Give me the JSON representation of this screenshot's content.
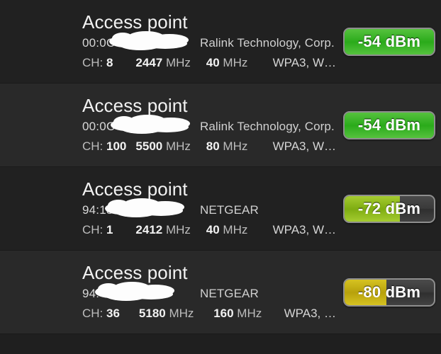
{
  "screen": {
    "name": "wifi-access-point-scan-list",
    "background_color": "#1f1f1f",
    "row_bg_dark": "#212121",
    "row_bg_light": "#292929"
  },
  "labels": {
    "channel_label": "CH:",
    "mhz_unit": "MHz",
    "dbm_unit": "dBm"
  },
  "access_points": [
    {
      "title": "Access point",
      "mac": "00:0C",
      "mac_redacted": true,
      "vendor": "Ralink Technology, Corp.",
      "channel": "8",
      "frequency": "2447",
      "bandwidth": "40",
      "security": "WPA3, W…",
      "signal_value": "-54",
      "signal_text": "-54 dBm",
      "signal_fill_percent": 100,
      "signal_color": "#2bab1b",
      "signal_color_light": "#56c23e",
      "row_background": "#212121"
    },
    {
      "title": "Access point",
      "mac": "00:0C",
      "mac_redacted": true,
      "vendor": "Ralink Technology, Corp.",
      "channel": "100",
      "frequency": "5500",
      "bandwidth": "80",
      "security": "WPA3, W…",
      "signal_value": "-54",
      "signal_text": "-54 dBm",
      "signal_fill_percent": 100,
      "signal_color": "#2bab1b",
      "signal_color_light": "#56c23e",
      "row_background": "#292929"
    },
    {
      "title": "Access point",
      "mac": "94:18:",
      "mac_redacted": true,
      "vendor": "NETGEAR",
      "channel": "1",
      "frequency": "2412",
      "bandwidth": "40",
      "security": "WPA3, W…",
      "signal_value": "-72",
      "signal_text": "-72 dBm",
      "signal_fill_percent": 62,
      "signal_color": "#7fad12",
      "signal_color_light": "#a5cc30",
      "row_background": "#212121"
    },
    {
      "title": "Access point",
      "mac": "94:",
      "mac_redacted": true,
      "vendor": "NETGEAR",
      "channel": "36",
      "frequency": "5180",
      "bandwidth": "160",
      "security": "WPA3, …",
      "signal_value": "-80",
      "signal_text": "-80 dBm",
      "signal_fill_percent": 47,
      "signal_color": "#b8a20c",
      "signal_color_light": "#d6c321",
      "row_background": "#292929"
    }
  ]
}
